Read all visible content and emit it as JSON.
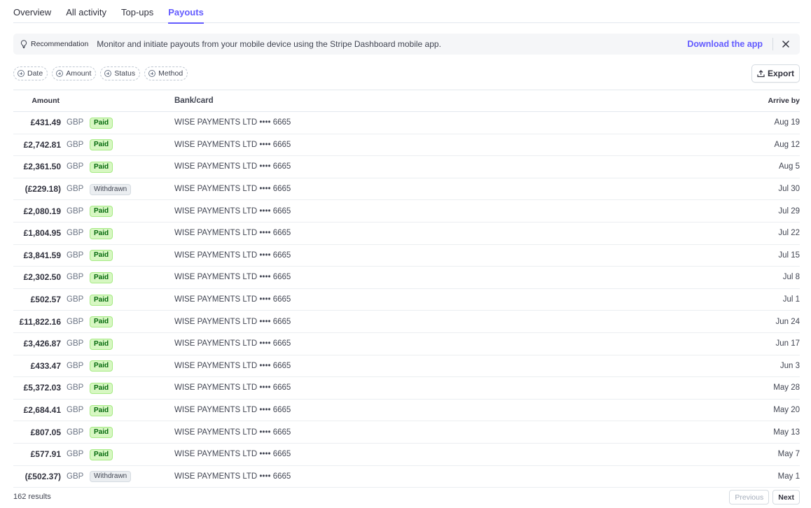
{
  "tabs": [
    {
      "label": "Overview",
      "active": false
    },
    {
      "label": "All activity",
      "active": false
    },
    {
      "label": "Top-ups",
      "active": false
    },
    {
      "label": "Payouts",
      "active": true
    }
  ],
  "banner": {
    "label": "Recommendation",
    "text": "Monitor and initiate payouts from your mobile device using the Stripe Dashboard mobile app.",
    "link": "Download the app"
  },
  "filters": [
    "Date",
    "Amount",
    "Status",
    "Method"
  ],
  "export_label": "Export",
  "table": {
    "headers": {
      "amount": "Amount",
      "bank": "Bank/card",
      "arrive": "Arrive by"
    },
    "rows": [
      {
        "amount": "£431.49",
        "currency": "GBP",
        "status": "Paid",
        "bank": "WISE PAYMENTS LTD •••• 6665",
        "arrive": "Aug 19"
      },
      {
        "amount": "£2,742.81",
        "currency": "GBP",
        "status": "Paid",
        "bank": "WISE PAYMENTS LTD •••• 6665",
        "arrive": "Aug 12"
      },
      {
        "amount": "£2,361.50",
        "currency": "GBP",
        "status": "Paid",
        "bank": "WISE PAYMENTS LTD •••• 6665",
        "arrive": "Aug 5"
      },
      {
        "amount": "(£229.18)",
        "currency": "GBP",
        "status": "Withdrawn",
        "bank": "WISE PAYMENTS LTD •••• 6665",
        "arrive": "Jul 30"
      },
      {
        "amount": "£2,080.19",
        "currency": "GBP",
        "status": "Paid",
        "bank": "WISE PAYMENTS LTD •••• 6665",
        "arrive": "Jul 29"
      },
      {
        "amount": "£1,804.95",
        "currency": "GBP",
        "status": "Paid",
        "bank": "WISE PAYMENTS LTD •••• 6665",
        "arrive": "Jul 22"
      },
      {
        "amount": "£3,841.59",
        "currency": "GBP",
        "status": "Paid",
        "bank": "WISE PAYMENTS LTD •••• 6665",
        "arrive": "Jul 15"
      },
      {
        "amount": "£2,302.50",
        "currency": "GBP",
        "status": "Paid",
        "bank": "WISE PAYMENTS LTD •••• 6665",
        "arrive": "Jul 8"
      },
      {
        "amount": "£502.57",
        "currency": "GBP",
        "status": "Paid",
        "bank": "WISE PAYMENTS LTD •••• 6665",
        "arrive": "Jul 1"
      },
      {
        "amount": "£11,822.16",
        "currency": "GBP",
        "status": "Paid",
        "bank": "WISE PAYMENTS LTD •••• 6665",
        "arrive": "Jun 24"
      },
      {
        "amount": "£3,426.87",
        "currency": "GBP",
        "status": "Paid",
        "bank": "WISE PAYMENTS LTD •••• 6665",
        "arrive": "Jun 17"
      },
      {
        "amount": "£433.47",
        "currency": "GBP",
        "status": "Paid",
        "bank": "WISE PAYMENTS LTD •••• 6665",
        "arrive": "Jun 3"
      },
      {
        "amount": "£5,372.03",
        "currency": "GBP",
        "status": "Paid",
        "bank": "WISE PAYMENTS LTD •••• 6665",
        "arrive": "May 28"
      },
      {
        "amount": "£2,684.41",
        "currency": "GBP",
        "status": "Paid",
        "bank": "WISE PAYMENTS LTD •••• 6665",
        "arrive": "May 20"
      },
      {
        "amount": "£807.05",
        "currency": "GBP",
        "status": "Paid",
        "bank": "WISE PAYMENTS LTD •••• 6665",
        "arrive": "May 13"
      },
      {
        "amount": "£577.91",
        "currency": "GBP",
        "status": "Paid",
        "bank": "WISE PAYMENTS LTD •••• 6665",
        "arrive": "May 7"
      },
      {
        "amount": "(£502.37)",
        "currency": "GBP",
        "status": "Withdrawn",
        "bank": "WISE PAYMENTS LTD •••• 6665",
        "arrive": "May 1"
      }
    ]
  },
  "footer": {
    "results": "162 results",
    "previous": "Previous",
    "next": "Next"
  },
  "colors": {
    "accent": "#635bff",
    "paid_bg": "#d7f7c2",
    "paid_text": "#05690d",
    "withdrawn_bg": "#ebeef1"
  }
}
